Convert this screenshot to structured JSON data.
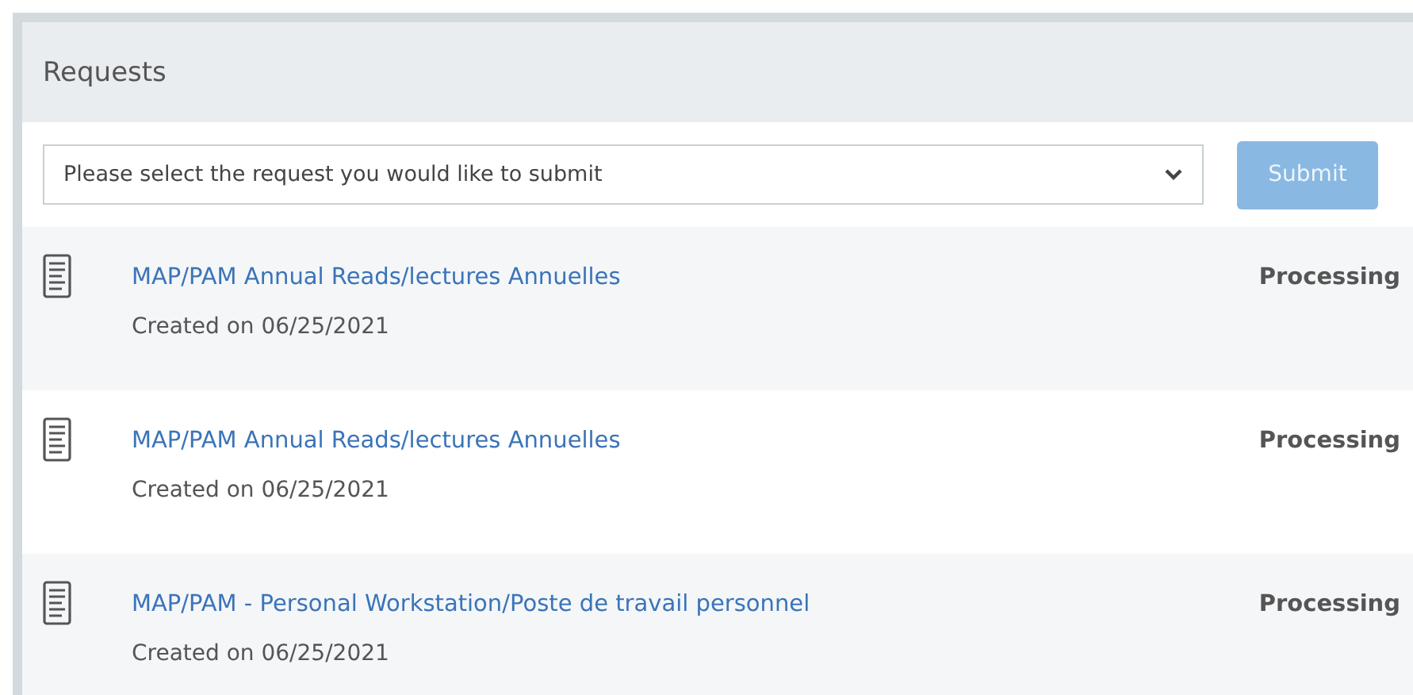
{
  "panel": {
    "title": "Requests"
  },
  "request_select": {
    "placeholder": "Please select the request you would like to submit"
  },
  "submit_button": {
    "label": "Submit",
    "disabled": true
  },
  "requests": [
    {
      "title": "MAP/PAM Annual Reads/lectures Annuelles",
      "created": "Created on 06/25/2021",
      "status": "Processing"
    },
    {
      "title": "MAP/PAM Annual Reads/lectures Annuelles",
      "created": "Created on 06/25/2021",
      "status": "Processing"
    },
    {
      "title": "MAP/PAM - Personal Workstation/Poste de travail personnel",
      "created": "Created on 06/25/2021",
      "status": "Processing"
    }
  ]
}
